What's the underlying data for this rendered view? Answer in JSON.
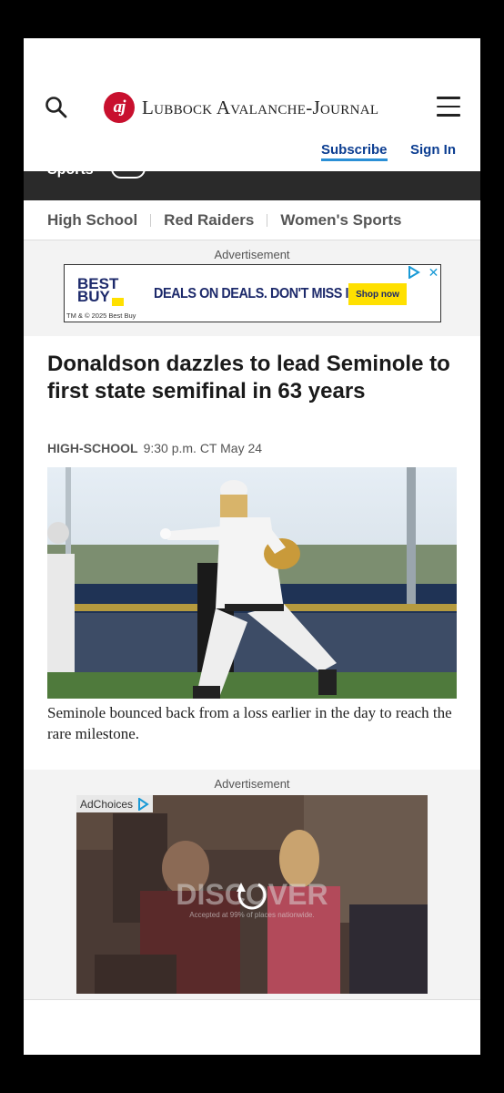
{
  "header": {
    "logo_mark": "aj",
    "publication_name": "Lubbock Avalanche-Journal",
    "subscribe_label": "Subscribe",
    "signin_label": "Sign In"
  },
  "section_bar": {
    "label": "Sports"
  },
  "subnav": {
    "items": [
      "High School",
      "Red Raiders",
      "Women's Sports"
    ]
  },
  "ad_top": {
    "label": "Advertisement",
    "brand": "BEST BUY",
    "headline": "DEALS ON DEALS. DON'T MISS IT.",
    "cta": "Shop now",
    "legal": "TM & © 2025 Best Buy"
  },
  "article": {
    "headline": "Donaldson dazzles to lead Seminole to first state semifinal in 63 years",
    "category": "HIGH-SCHOOL",
    "timestamp": "9:30 p.m. CT May 24",
    "caption": "Seminole bounced back from a loss earlier in the day to reach the rare milestone."
  },
  "ad_bottom": {
    "label": "Advertisement",
    "adchoices": "AdChoices",
    "brand": "DISCOVER",
    "tagline": "Accepted at 99% of places nationwide."
  },
  "colors": {
    "brand_red": "#c8102e",
    "link_blue": "#0b3d91",
    "underline_blue": "#2a8fd6",
    "section_bar": "#2a2a2a"
  }
}
